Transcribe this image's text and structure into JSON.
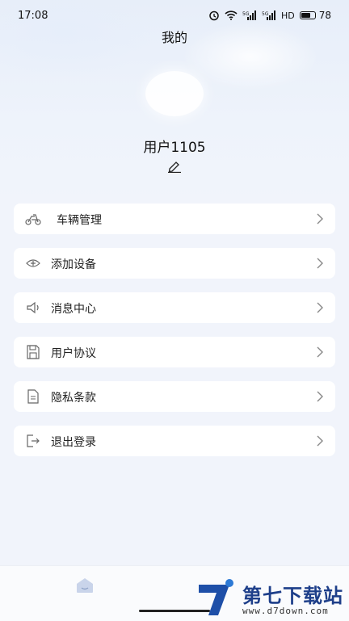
{
  "status_bar": {
    "time": "17:08",
    "network": "HD",
    "battery": "78",
    "battery_level": 0.78
  },
  "header": {
    "title": "我的"
  },
  "profile": {
    "username": "用户1105"
  },
  "menu": [
    {
      "label": "车辆管理",
      "icon": "scooter-icon"
    },
    {
      "label": "添加设备",
      "icon": "add-device-icon"
    },
    {
      "label": "消息中心",
      "icon": "speaker-icon"
    },
    {
      "label": "用户协议",
      "icon": "save-document-icon"
    },
    {
      "label": "隐私条款",
      "icon": "document-icon"
    },
    {
      "label": "退出登录",
      "icon": "logout-icon"
    }
  ],
  "watermark": {
    "title": "第七下载站",
    "url": "www.d7down.com"
  }
}
